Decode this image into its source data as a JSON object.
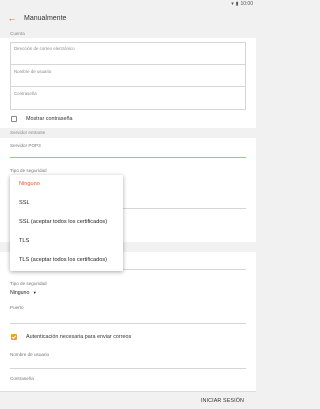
{
  "status": {
    "time": "10:00"
  },
  "header": {
    "title": "Manualmente"
  },
  "cuenta": {
    "section": "Cuenta",
    "email_placeholder": "Dirección de correo electrónico",
    "user_placeholder": "Nombre de usuario",
    "password_placeholder": "Contraseña",
    "show_password": "Mostrar contraseña"
  },
  "incoming": {
    "section": "Servidor entrante",
    "server_label": "Servidor POP3",
    "security_label": "Tipo de seguridad"
  },
  "security_dropdown": {
    "options": [
      "Ninguno",
      "SSL",
      "SSL (aceptar todos los certificados)",
      "TLS",
      "TLS (aceptar todos los certificados)"
    ],
    "selected": "Ninguno"
  },
  "outgoing": {
    "security_label": "Tipo de seguridad",
    "security_value": "Ninguno",
    "port_label": "Puerto",
    "auth_label": "Autenticación necesaria para enviar correos",
    "user_label": "Nombre de usuario",
    "password_label": "Contraseña"
  },
  "footer": {
    "signin": "INICIAR SESIÓN"
  },
  "colors": {
    "accent": "#e8572a",
    "checkbox": "#f0a020"
  }
}
